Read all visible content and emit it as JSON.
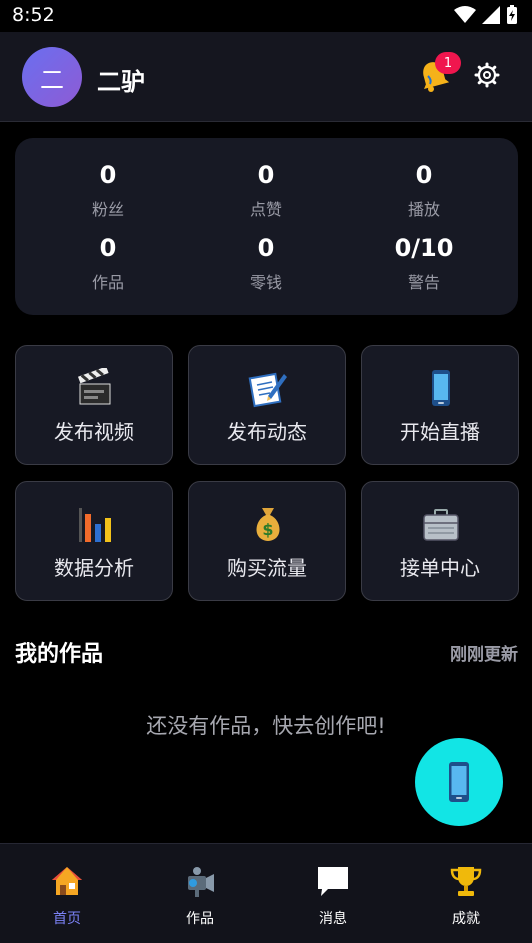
{
  "status_bar": {
    "time": "8:52"
  },
  "header": {
    "avatar_text": "二",
    "username": "二驴",
    "notification_count": "1"
  },
  "stats": [
    {
      "value": "0",
      "label": "粉丝"
    },
    {
      "value": "0",
      "label": "点赞"
    },
    {
      "value": "0",
      "label": "播放"
    },
    {
      "value": "0",
      "label": "作品"
    },
    {
      "value": "0",
      "label": "零钱"
    },
    {
      "value": "0/10",
      "label": "警告"
    }
  ],
  "actions": [
    {
      "label": "发布视频",
      "icon": "clapperboard-icon"
    },
    {
      "label": "发布动态",
      "icon": "memo-icon"
    },
    {
      "label": "开始直播",
      "icon": "mobile-phone-icon"
    },
    {
      "label": "数据分析",
      "icon": "bar-chart-icon"
    },
    {
      "label": "购买流量",
      "icon": "money-bag-icon"
    },
    {
      "label": "接单中心",
      "icon": "briefcase-icon"
    }
  ],
  "works": {
    "title": "我的作品",
    "refresh_label": "刚刚更新",
    "empty_text": "还没有作品，快去创作吧!"
  },
  "tabbar": {
    "items": [
      {
        "label": "首页",
        "icon": "home-icon",
        "active": true
      },
      {
        "label": "作品",
        "icon": "camera-icon",
        "active": false
      },
      {
        "label": "消息",
        "icon": "message-icon",
        "active": false
      },
      {
        "label": "成就",
        "icon": "trophy-icon",
        "active": false
      }
    ]
  },
  "colors": {
    "accent": "#7b82f5",
    "fab": "#12e5e5",
    "badge": "#f0164e",
    "card": "#171924"
  }
}
